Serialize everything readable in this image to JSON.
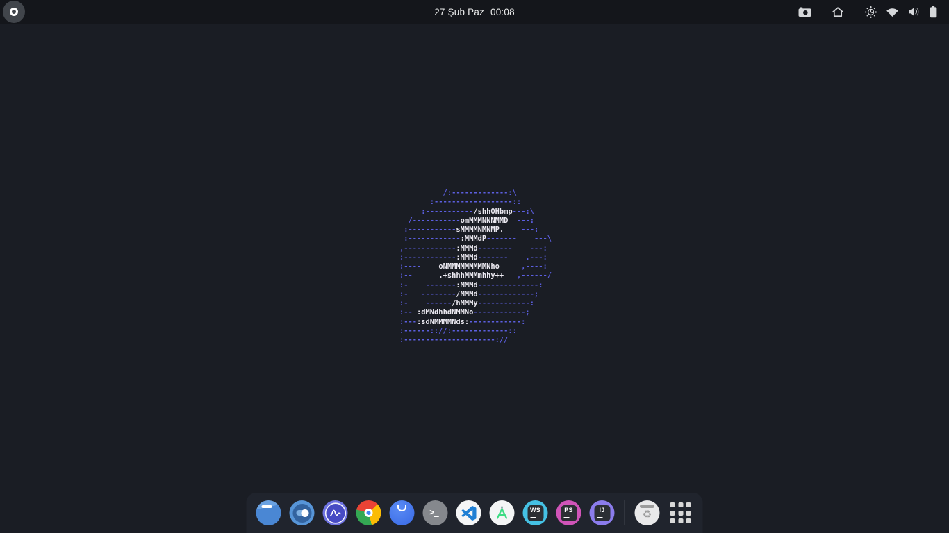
{
  "topbar": {
    "date": "27 Şub Paz",
    "time": "00:08",
    "left_button_icon": "circle-ring-icon",
    "right_icons": [
      "screenshot-camera-icon",
      "home-icon",
      "night-light-icon",
      "wifi-icon",
      "volume-icon",
      "battery-icon"
    ]
  },
  "wallpaper": {
    "ascii_art": {
      "theme": "solus-logo",
      "accent_color": "#5c5fe0",
      "bright_color": "#eceaf2",
      "lines": [
        [
          [
            "b",
            "          /:-------------:\\"
          ]
        ],
        [
          [
            "b",
            "       :------------------::"
          ]
        ],
        [
          [
            "b",
            "     :-----------"
          ],
          [
            "w",
            "/shhOHbmp"
          ],
          [
            "b",
            "---:\\"
          ]
        ],
        [
          [
            "b",
            "  /-----------"
          ],
          [
            "w",
            "omMMMNNNMMD"
          ],
          [
            "b",
            "  ---:"
          ]
        ],
        [
          [
            "b",
            " :-----------"
          ],
          [
            "w",
            "sMMMMNMNMP."
          ],
          [
            "b",
            "    ---:"
          ]
        ],
        [
          [
            "b",
            " :------------"
          ],
          [
            "w",
            ":MMMdP"
          ],
          [
            "b",
            "-------    ---\\"
          ]
        ],
        [
          [
            "b",
            ",------------"
          ],
          [
            "w",
            ":MMMd"
          ],
          [
            "b",
            "--------    ---:"
          ]
        ],
        [
          [
            "b",
            ":------------"
          ],
          [
            "w",
            ":MMMd"
          ],
          [
            "b",
            "-------    .---:"
          ]
        ],
        [
          [
            "b",
            ":----    "
          ],
          [
            "w",
            "oNMMMMMMMMMNho"
          ],
          [
            "b",
            "     ,----:"
          ]
        ],
        [
          [
            "b",
            ":--      "
          ],
          [
            "w",
            ".+shhhMMMmhhy++"
          ],
          [
            "b",
            "   ,------/"
          ]
        ],
        [
          [
            "b",
            ":-    -------"
          ],
          [
            "w",
            ":MMMd"
          ],
          [
            "b",
            "--------------:"
          ]
        ],
        [
          [
            "b",
            ":-   --------"
          ],
          [
            "w",
            "/MMMd"
          ],
          [
            "b",
            "-------------;"
          ]
        ],
        [
          [
            "b",
            ":-    ------"
          ],
          [
            "w",
            "/hMMMy"
          ],
          [
            "b",
            "------------:"
          ]
        ],
        [
          [
            "b",
            ":-- "
          ],
          [
            "w",
            ":dMNdhhdNMMNo"
          ],
          [
            "b",
            "------------;"
          ]
        ],
        [
          [
            "b",
            ":---"
          ],
          [
            "w",
            ":sdNMMMMNds:"
          ],
          [
            "b",
            "------------:"
          ]
        ],
        [
          [
            "b",
            ":------:://:-------------::"
          ]
        ],
        [
          [
            "b",
            ":---------------------://"
          ]
        ]
      ]
    }
  },
  "dock": {
    "items": [
      {
        "id": "files",
        "icon": "files-icon"
      },
      {
        "id": "settings",
        "icon": "settings-toggle-icon"
      },
      {
        "id": "system-monitor",
        "icon": "activity-wave-icon"
      },
      {
        "id": "chrome",
        "icon": "chrome-icon"
      },
      {
        "id": "insomnia",
        "icon": "insomnia-icon"
      },
      {
        "id": "terminal",
        "icon": "terminal-icon",
        "glyph": ">_"
      },
      {
        "id": "vscode",
        "icon": "vscode-icon"
      },
      {
        "id": "android-studio",
        "icon": "android-studio-icon"
      },
      {
        "id": "webstorm",
        "icon": "webstorm-icon",
        "badge": "WS",
        "color": "#45c1e4"
      },
      {
        "id": "phpstorm",
        "icon": "phpstorm-icon",
        "badge": "PS",
        "color": "#d054b8"
      },
      {
        "id": "intellij-idea",
        "icon": "intellij-icon",
        "badge": "IJ",
        "color": "#8b7cec"
      }
    ],
    "trash_icon": "trash-icon",
    "app_grid_icon": "show-applications-icon",
    "recycle_glyph": "♻"
  }
}
